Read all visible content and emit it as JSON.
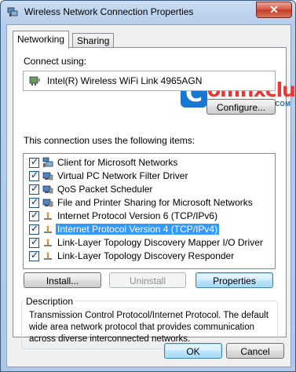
{
  "window": {
    "title": "Wireless Network Connection Properties",
    "close_label": "✕"
  },
  "tabs": [
    {
      "label": "Networking",
      "active": true
    },
    {
      "label": "Sharing",
      "active": false
    }
  ],
  "connect_using": {
    "label": "Connect using:",
    "adapter": "Intel(R) Wireless WiFi Link 4965AGN",
    "configure_button": "Configure..."
  },
  "items_section": {
    "label": "This connection uses the following items:",
    "items": [
      {
        "label": "Client for Microsoft Networks",
        "checked": true,
        "icon": "network-client-icon"
      },
      {
        "label": "Virtual PC Network Filter Driver",
        "checked": true,
        "icon": "network-service-icon"
      },
      {
        "label": "QoS Packet Scheduler",
        "checked": true,
        "icon": "network-service-icon"
      },
      {
        "label": "File and Printer Sharing for Microsoft Networks",
        "checked": true,
        "icon": "network-service-icon"
      },
      {
        "label": "Internet Protocol Version 6 (TCP/IPv6)",
        "checked": true,
        "icon": "protocol-icon"
      },
      {
        "label": "Internet Protocol Version 4 (TCP/IPv4)",
        "checked": true,
        "icon": "protocol-icon",
        "selected": true
      },
      {
        "label": "Link-Layer Topology Discovery Mapper I/O Driver",
        "checked": true,
        "icon": "protocol-icon"
      },
      {
        "label": "Link-Layer Topology Discovery Responder",
        "checked": true,
        "icon": "protocol-icon"
      }
    ]
  },
  "buttons": {
    "install": "Install...",
    "uninstall": "Uninstall",
    "properties": "Properties",
    "ok": "OK",
    "cancel": "Cancel"
  },
  "description": {
    "title": "Description",
    "text": "Transmission Control Protocol/Internet Protocol. The default wide area network protocol that provides communication across diverse interconnected networks."
  },
  "watermark": {
    "letter": "C",
    "word": "omfixclub",
    "url": "WWW.COMFIXCLUB.COM"
  },
  "colors": {
    "selection": "#3399ff",
    "close_red": "#c33a22",
    "logo_red": "#e53935",
    "logo_blue": "#1976d2"
  }
}
